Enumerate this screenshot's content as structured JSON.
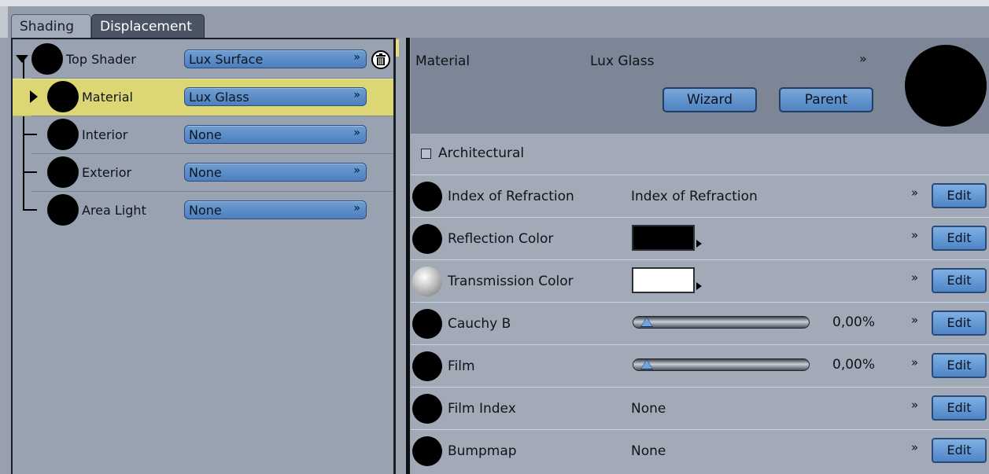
{
  "tabs": [
    {
      "label": "Shading",
      "active": true
    },
    {
      "label": "Displacement",
      "active": false
    }
  ],
  "tree": [
    {
      "label": "Top Shader",
      "value": "Lux Surface",
      "selected": false
    },
    {
      "label": "Material",
      "value": "Lux Glass",
      "selected": true
    },
    {
      "label": "Interior",
      "value": "None",
      "selected": false
    },
    {
      "label": "Exterior",
      "value": "None",
      "selected": false
    },
    {
      "label": "Area Light",
      "value": "None",
      "selected": false
    }
  ],
  "header": {
    "label": "Material",
    "value": "Lux Glass",
    "wizard_label": "Wizard",
    "parent_label": "Parent"
  },
  "architectural": {
    "label": "Architectural",
    "checked": false
  },
  "properties": [
    {
      "name": "Index of Refraction",
      "kind": "text",
      "value": "Index of Refraction",
      "edit": "Edit"
    },
    {
      "name": "Reflection Color",
      "kind": "color",
      "color": "#000000",
      "edit": "Edit"
    },
    {
      "name": "Transmission Color",
      "kind": "color",
      "color": "#ffffff",
      "edit": "Edit"
    },
    {
      "name": "Cauchy B",
      "kind": "slider",
      "value": "0,00%",
      "edit": "Edit"
    },
    {
      "name": "Film",
      "kind": "slider",
      "value": "0,00%",
      "edit": "Edit"
    },
    {
      "name": "Film Index",
      "kind": "text",
      "value": "None",
      "edit": "Edit"
    },
    {
      "name": "Bumpmap",
      "kind": "text",
      "value": "None",
      "edit": "Edit"
    }
  ],
  "colors": {
    "selection": "#dcd774",
    "button": "#5b8fcd",
    "panel": "#a2aab7"
  }
}
